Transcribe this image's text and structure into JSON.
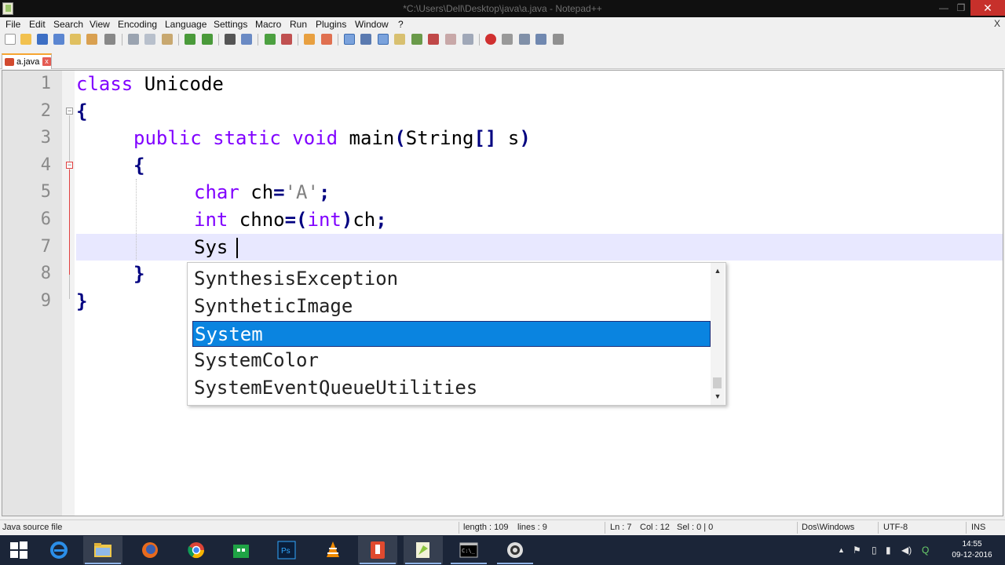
{
  "window": {
    "title": "*C:\\Users\\Dell\\Desktop\\java\\a.java - Notepad++",
    "minimize": "—",
    "maximize": "❐",
    "close": "✕"
  },
  "menu": [
    "File",
    "Edit",
    "Search",
    "View",
    "Encoding",
    "Language",
    "Settings",
    "Macro",
    "Run",
    "Plugins",
    "Window",
    "?"
  ],
  "menu_close": "X",
  "tab": {
    "label": "a.java",
    "close": "x"
  },
  "code": {
    "line_numbers": [
      "1",
      "2",
      "3",
      "4",
      "5",
      "6",
      "7",
      "8",
      "9"
    ],
    "line1": {
      "kw": "class",
      "rest": " Unicode"
    },
    "line2": {
      "brace": "{"
    },
    "line3": {
      "kw": "public static void",
      "name": " main",
      "open": "(",
      "type": "String",
      "brackets": "[]",
      "arg": " s",
      "close": ")"
    },
    "line4": {
      "brace": "{"
    },
    "line5": {
      "kw": "char",
      "rest": " ch",
      "eq": "=",
      "str": "'A'",
      "semi": ";"
    },
    "line6": {
      "kw": "int",
      "rest": " chno",
      "eq": "=(",
      "cast": "int",
      "paren": ")",
      "var": "ch",
      "semi": ";"
    },
    "line7": {
      "typed": "Sys"
    },
    "line8": {
      "brace": "}"
    },
    "line9": {
      "brace": "}"
    }
  },
  "autocomplete": {
    "options": [
      "SynthesisException",
      "SyntheticImage",
      "System",
      "SystemColor",
      "SystemEventQueueUtilities"
    ],
    "selected_index": 2,
    "scroll_up": "▲",
    "scroll_down": "▼"
  },
  "status": {
    "file_type": "Java source file",
    "length": "length : 109",
    "lines": "lines : 9",
    "ln": "Ln : 7",
    "col": "Col : 12",
    "sel": "Sel : 0 | 0",
    "eol": "Dos\\Windows",
    "encoding": "UTF-8",
    "mode": "INS"
  },
  "taskbar": {
    "apps": [
      "start",
      "internet-explorer",
      "file-explorer",
      "firefox",
      "chrome",
      "store",
      "photoshop",
      "vlc",
      "java-app",
      "notepad-plus-plus",
      "command-prompt",
      "recorder"
    ],
    "clock_time": "14:55",
    "clock_date": "09-12-2016"
  },
  "colors": {
    "keyword": "#8000ff",
    "operator": "#000080",
    "string": "#808080",
    "selection": "#0a84e0",
    "current_line": "#e8e8ff"
  }
}
